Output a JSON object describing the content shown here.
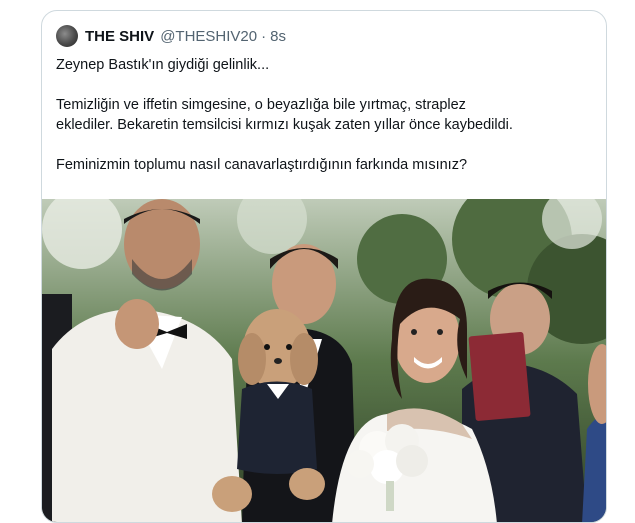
{
  "tweet": {
    "display_name": "THE SHIV",
    "handle": "@THESHIV20",
    "separator": "·",
    "time": "8s",
    "lines": [
      "Zeynep Bastık'ın giydiği gelinlik...",
      "Temizliğin ve iffetin simgesine, o beyazlığa bile yırtmaç, straplez",
      "eklediler. Bekaretin temsilcisi kırmızı kuşak zaten yıllar önce kaybedildi.",
      "Feminizmin toplumu nasıl canavarlaştırdığının farkında mısınız?"
    ],
    "photo": {
      "subject": "wedding photo: bride in white gown holding bouquet, dog in tuxedo, groomsmen in tuxedos, man holding red passport-like document",
      "colors": {
        "foliage": "#3f5a34",
        "sky": "#c9d6c4",
        "jacket_white": "#f1efea",
        "tux_black": "#15161a",
        "skin": "#c99a7c",
        "dog": "#c9a07a",
        "passport": "#8c2a35"
      }
    }
  }
}
